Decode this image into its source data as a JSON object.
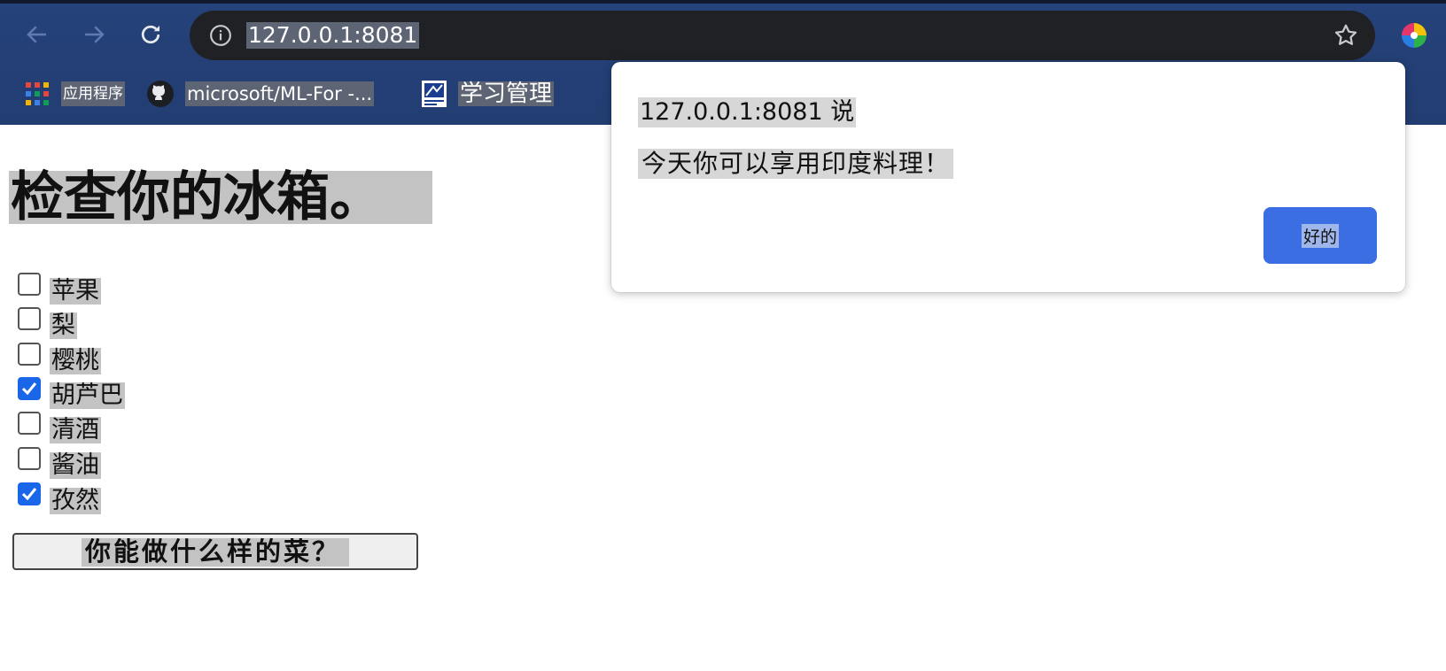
{
  "browser": {
    "url": "127.0.0.1:8081",
    "bookmarks": [
      {
        "label": "应用程序",
        "icon": "apps-grid-icon"
      },
      {
        "label": "microsoft/ML-For -...",
        "icon": "github-icon"
      },
      {
        "label": "学习管理",
        "icon": "bookmark-favicon"
      }
    ]
  },
  "page": {
    "title": "检查你的冰箱。",
    "items": [
      {
        "label": "苹果",
        "checked": false
      },
      {
        "label": "梨",
        "checked": false
      },
      {
        "label": "樱桃",
        "checked": false
      },
      {
        "label": "胡芦巴",
        "checked": true
      },
      {
        "label": "清酒",
        "checked": false
      },
      {
        "label": "酱油",
        "checked": false
      },
      {
        "label": "孜然",
        "checked": true
      }
    ],
    "button_label": "你能做什么样的菜？"
  },
  "dialog": {
    "origin": "127.0.0.1:8081 说",
    "message": "今天你可以享用印度料理！",
    "ok_label": "好的"
  },
  "colors": {
    "chrome_bg": "#223d72",
    "omnibox_bg": "#202124",
    "checkbox_checked": "#1a66e8",
    "dialog_button": "#3c6ee3"
  }
}
